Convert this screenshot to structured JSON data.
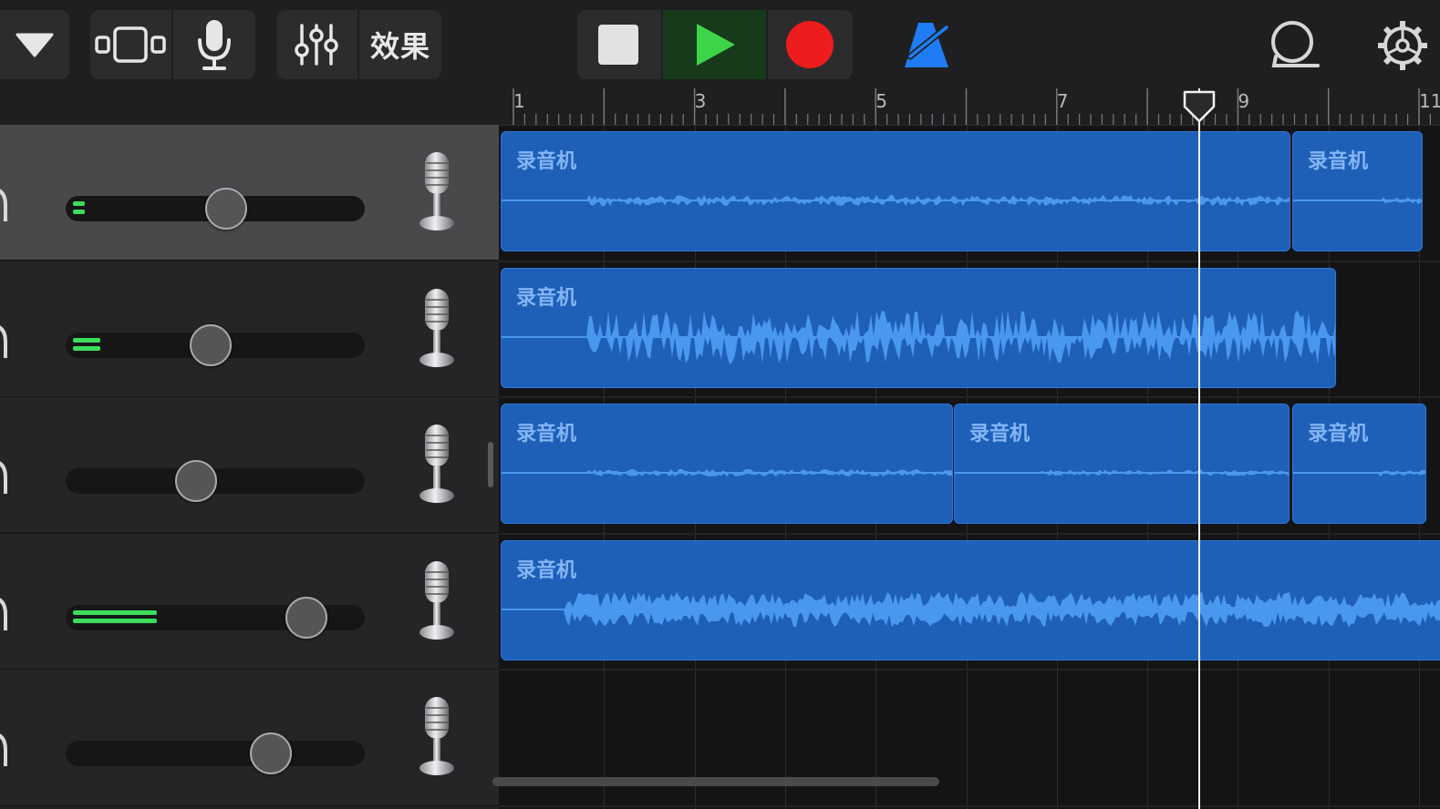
{
  "toolbar": {
    "effects_label": "效果"
  },
  "ruler": {
    "bar_numbers": [
      "1",
      "3",
      "5",
      "7",
      "9",
      "11"
    ]
  },
  "tracks": [
    {
      "selected": true,
      "volume": 0.53,
      "level_bars": 2,
      "level": 0.04
    },
    {
      "selected": false,
      "volume": 0.48,
      "level_bars": 2,
      "level": 0.09
    },
    {
      "selected": false,
      "volume": 0.43,
      "level_bars": 0,
      "level": 0
    },
    {
      "selected": false,
      "volume": 0.8,
      "level_bars": 2,
      "level": 0.28
    },
    {
      "selected": false,
      "volume": 0.68,
      "level_bars": 0,
      "level": 0
    }
  ],
  "regions": [
    {
      "track": 0,
      "label": "录音机"
    },
    {
      "track": 0,
      "label": "录音机"
    },
    {
      "track": 1,
      "label": "录音机"
    },
    {
      "track": 2,
      "label": "录音机"
    },
    {
      "track": 2,
      "label": "录音机"
    },
    {
      "track": 2,
      "label": "录音机"
    },
    {
      "track": 3,
      "label": "录音机"
    }
  ],
  "colors": {
    "region": "#1e5fb8",
    "waveform": "#4a97f0",
    "play": "#3dd44a",
    "record": "#ee1c1c",
    "metronome": "#1f7cf5",
    "level_meter": "#3ddc5a"
  },
  "icons": [
    "chevron-down-icon",
    "track-view-icon",
    "microphone-icon",
    "mixer-icon",
    "stop-icon",
    "play-icon",
    "record-icon",
    "metronome-icon",
    "loop-icon",
    "settings-icon",
    "headphone-icon",
    "vintage-microphone-icon"
  ]
}
